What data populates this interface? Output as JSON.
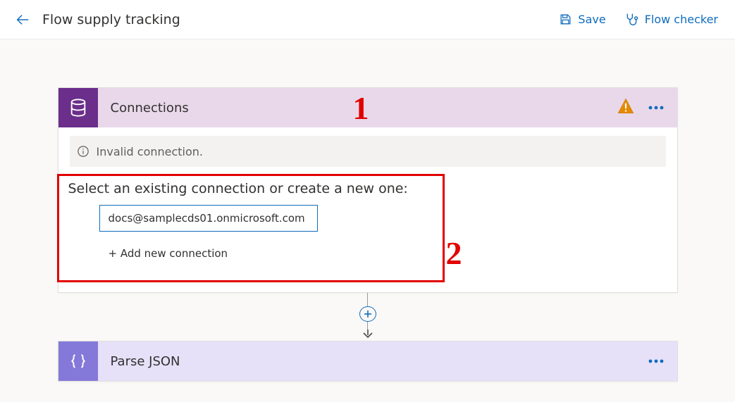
{
  "header": {
    "title": "Flow supply tracking",
    "save_label": "Save",
    "checker_label": "Flow checker"
  },
  "connections_card": {
    "title": "Connections",
    "banner_text": "Invalid connection.",
    "prompt": "Select an existing connection or create a new one:",
    "options": [
      {
        "label": "docs@samplecds01.onmicrosoft.com",
        "selected": true
      },
      {
        "label": "+ Add new connection",
        "selected": false
      }
    ]
  },
  "parse_card": {
    "title": "Parse JSON"
  },
  "annotations": {
    "one": "1",
    "two": "2"
  }
}
